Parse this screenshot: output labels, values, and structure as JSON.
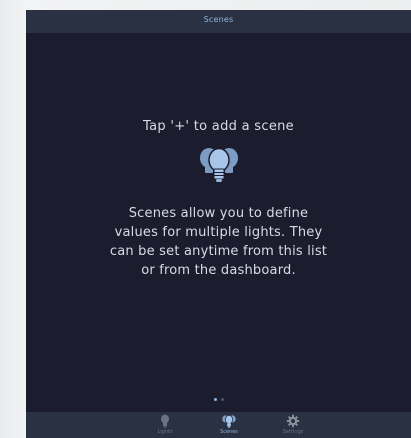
{
  "header": {
    "title": "Scenes"
  },
  "empty_state": {
    "heading": "Tap '+' to add a scene",
    "icon": "light-bulbs-icon",
    "description": "Scenes allow you to define values for multiple lights. They can be set anytime from this list or from the dashboard."
  },
  "pagination": {
    "pages": 2,
    "current": 1
  },
  "tabbar": {
    "tabs": [
      {
        "label": "Lights",
        "icon": "light-bulb-icon",
        "selected": false
      },
      {
        "label": "Scenes",
        "icon": "light-bulbs-icon",
        "selected": true
      },
      {
        "label": "Settings",
        "icon": "gear-icon",
        "selected": false
      }
    ]
  },
  "colors": {
    "background": "#1b1d2e",
    "bar": "#2a3143",
    "accent": "#8fb3dd",
    "text": "#d7dbe6",
    "inactive": "#6b7280"
  }
}
